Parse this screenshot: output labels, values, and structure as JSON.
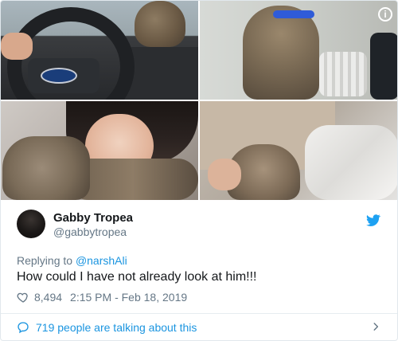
{
  "tweet": {
    "display_name": "Gabby Tropea",
    "handle": "@gabbytropea",
    "replying_to_prefix": "Replying to",
    "replying_to_handle": "@narshAli",
    "text": "How could I have not already look at him!!!",
    "likes": "8,494",
    "time": "2:15 PM - Feb 18, 2019",
    "footer_text": "719 people are talking about this"
  },
  "ui": {
    "info_icon_text": "i",
    "accent_color": "#1b95e0",
    "text_secondary_color": "#657786",
    "text_primary_color": "#14171a",
    "icons": {
      "info": "info-icon",
      "twitter": "twitter-bird-icon",
      "like": "heart-icon",
      "conversation": "speech-bubble-icon",
      "chevron": "chevron-right-icon"
    }
  }
}
